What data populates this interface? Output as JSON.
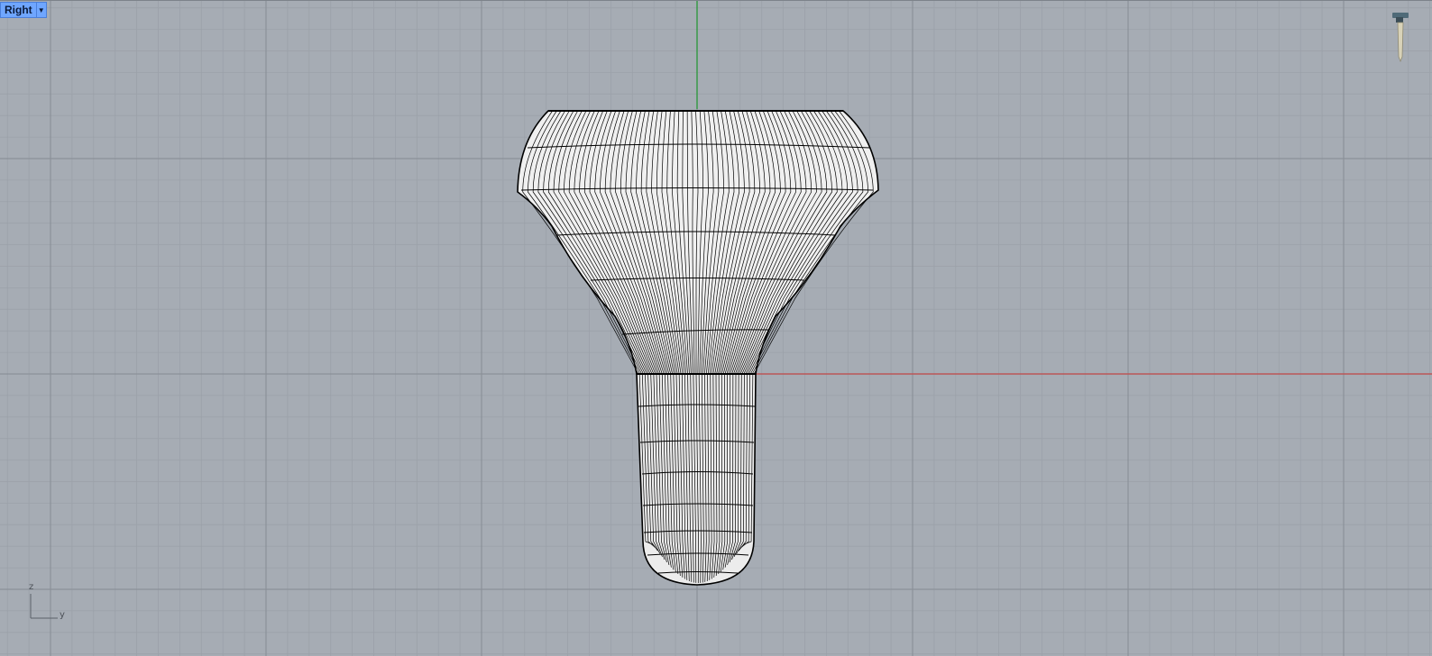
{
  "viewport": {
    "title": "Right",
    "menu_icon": "dropdown-arrow-icon",
    "pin_icon": "pushpin-icon",
    "axes": {
      "vertical": "z",
      "horizontal": "y"
    },
    "colors": {
      "background": "#a6acb4",
      "grid_minor": "#9ba1a9",
      "grid_major": "#8b9199",
      "axis_x": "#c44a4a",
      "axis_y": "#2a9a3a",
      "wire": "#000000"
    }
  }
}
